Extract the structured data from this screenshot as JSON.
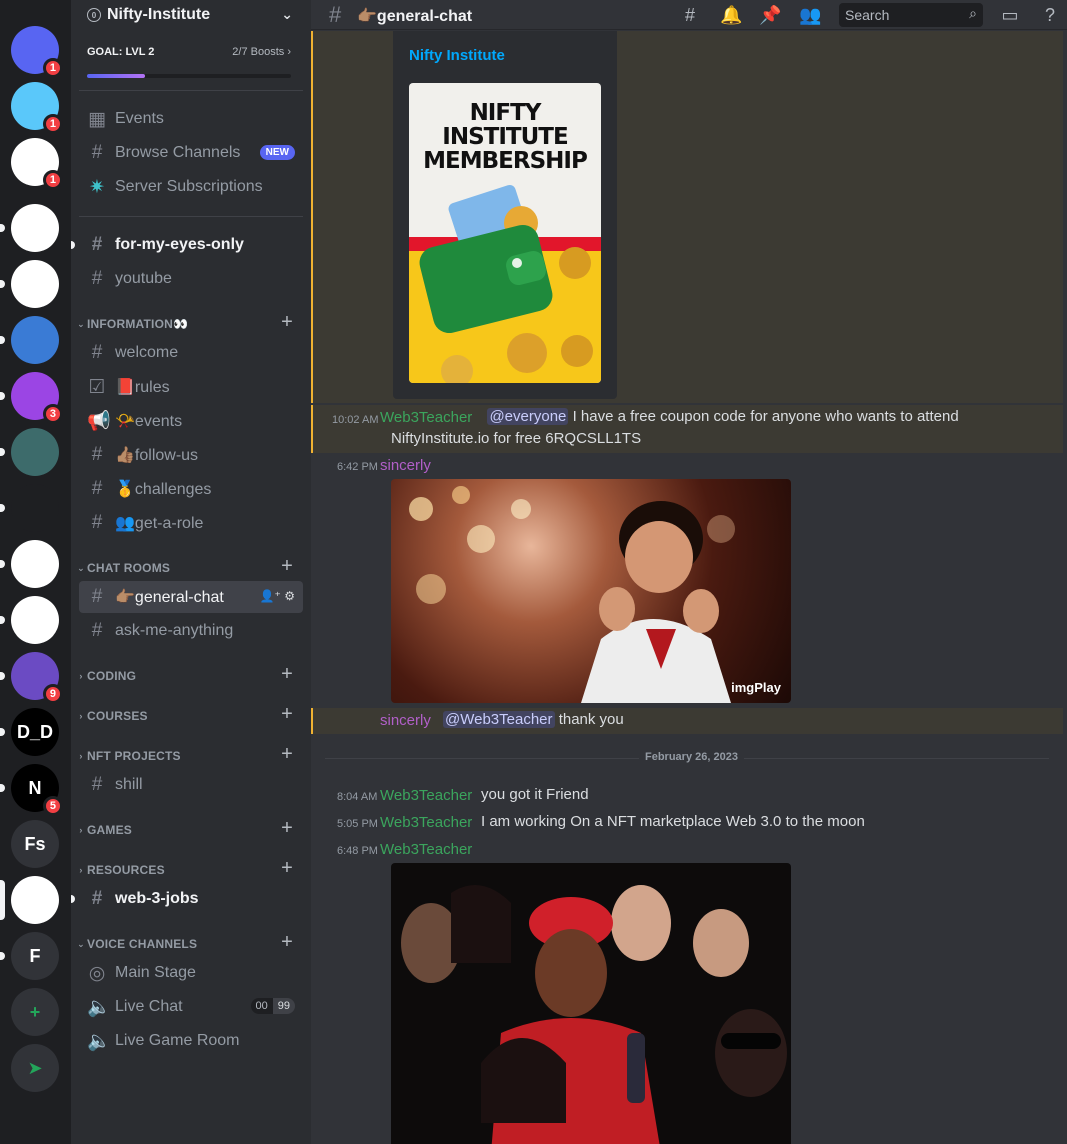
{
  "servers": [
    {
      "name": "discord-home",
      "label": "",
      "color": "#5865f2",
      "badge": "1",
      "indicator": "none"
    },
    {
      "name": "server-smiley",
      "label": "",
      "color": "#5ac8fa",
      "badge": "1",
      "indicator": "none"
    },
    {
      "name": "server-sailboat-1",
      "label": "",
      "color": "#ffffff",
      "badge": "1",
      "indicator": "none"
    },
    {
      "name": "server-sailboat-2",
      "label": "",
      "color": "#ffffff",
      "badge": "",
      "indicator": "dot"
    },
    {
      "name": "server-bracket-a",
      "label": "",
      "color": "#ffffff",
      "badge": "",
      "indicator": "dot"
    },
    {
      "name": "server-headset",
      "label": "",
      "color": "#3a7bd5",
      "badge": "",
      "indicator": "dot"
    },
    {
      "name": "server-cube",
      "label": "",
      "color": "#9b45e4",
      "badge": "3",
      "indicator": "dot"
    },
    {
      "name": "server-avatar",
      "label": "",
      "color": "#3d6b6b",
      "badge": "",
      "indicator": "dot"
    },
    {
      "name": "server-bird",
      "label": "",
      "color": "#1e1f22",
      "badge": "",
      "indicator": "dot"
    },
    {
      "name": "server-ring",
      "label": "",
      "color": "#ffffff",
      "badge": "",
      "indicator": "dot"
    },
    {
      "name": "server-openai",
      "label": "",
      "color": "#ffffff",
      "badge": "",
      "indicator": "dot"
    },
    {
      "name": "server-star",
      "label": "",
      "color": "#6b4bc3",
      "badge": "9",
      "indicator": "dot"
    },
    {
      "name": "server-dd",
      "label": "D_D",
      "color": "#000000",
      "badge": "",
      "indicator": "dot"
    },
    {
      "name": "server-n",
      "label": "N",
      "color": "#000000",
      "badge": "5",
      "indicator": "dot"
    },
    {
      "name": "server-fs",
      "label": "Fs",
      "color": "#313338",
      "badge": "",
      "indicator": "none"
    },
    {
      "name": "server-nifty",
      "label": "",
      "color": "#ffffff",
      "badge": "",
      "indicator": "pill"
    },
    {
      "name": "server-f",
      "label": "F",
      "color": "#313338",
      "badge": "",
      "indicator": "dot"
    },
    {
      "name": "add-server",
      "label": "+",
      "color": "#313338",
      "badge": "",
      "indicator": "none"
    },
    {
      "name": "explore",
      "label": "➤",
      "color": "#313338",
      "badge": "",
      "indicator": "none"
    }
  ],
  "server": {
    "name": "Nifty-Institute",
    "badge": "0"
  },
  "goal": {
    "label": "GOAL: LVL 2",
    "boosts": "2/7 Boosts",
    "progress": 0.286
  },
  "top_items": [
    {
      "label": "Events",
      "icon": "calendar-icon"
    },
    {
      "label": "Browse Channels",
      "icon": "browse-icon",
      "tag": "NEW"
    },
    {
      "label": "Server Subscriptions",
      "icon": "subscription-icon"
    }
  ],
  "channels": {
    "for_my_eyes_only": "for-my-eyes-only",
    "youtube": "youtube",
    "welcome": "welcome",
    "rules": "📕rules",
    "events": "📯events",
    "follow_us": "👍🏽follow-us",
    "challenges": "🥇challenges",
    "get_a_role": "👥get-a-role",
    "general_chat": "👉🏽general-chat",
    "ask_me_anything": "ask-me-anything",
    "shill": "shill",
    "web_3_jobs": "web-3-jobs",
    "main_stage": "Main Stage",
    "live_chat": "Live Chat",
    "live_game_room": "Live Game Room"
  },
  "categories": {
    "information": "INFORMATION👀",
    "chat_rooms": "CHAT ROOMS",
    "coding": "CODING",
    "courses": "COURSES",
    "nft_projects": "NFT PROJECTS",
    "games": "GAMES",
    "resources": "RESOURCES",
    "voice_channels": "VOICE CHANNELS"
  },
  "voice_count": {
    "a": "00",
    "b": "99"
  },
  "topbar": {
    "channel": "👉🏽general-chat",
    "search": "Search"
  },
  "messages": {
    "embed_title": "Nifty Institute",
    "poster": "NIFTY INSTITUTE MEMBERSHIP",
    "m1": {
      "time": "10:02 AM",
      "author": "Web3Teacher",
      "mention": "@everyone",
      "text": "I have a free coupon code for anyone who wants to attend",
      "text2": "NiftyInstitute.io for free 6RQCSLL1TS"
    },
    "m2": {
      "time": "6:42 PM",
      "author": "sincerly",
      "gif_watermark": "imgPlay"
    },
    "m3": {
      "author": "sincerly",
      "mention": "@Web3Teacher",
      "text": "thank you"
    },
    "date": "February 26, 2023",
    "m4": {
      "time": "8:04 AM",
      "author": "Web3Teacher",
      "text": "you got it Friend"
    },
    "m5": {
      "time": "5:05 PM",
      "author": "Web3Teacher",
      "text": "I am working On a NFT marketplace Web 3.0 to the moon"
    },
    "m6": {
      "time": "6:48 PM",
      "author": "Web3Teacher"
    }
  }
}
